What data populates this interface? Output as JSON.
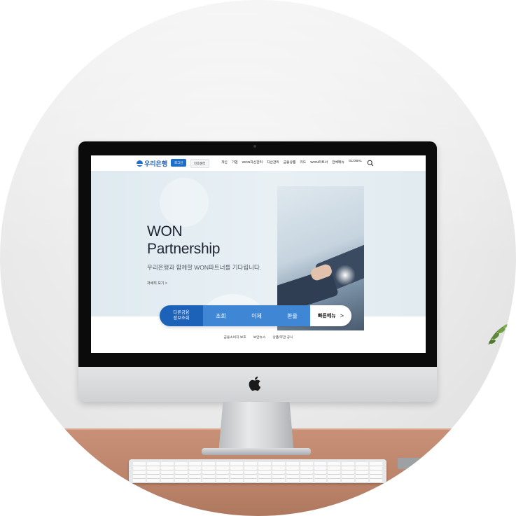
{
  "site": {
    "logo_text": "우리은행",
    "login_label": "로그인",
    "cert_label": "인증센터",
    "nav": [
      "개인",
      "기업",
      "WON자산관리",
      "자산관리",
      "금융상품",
      "카드",
      "WON파트너",
      "전체메뉴",
      "GLOBAL"
    ]
  },
  "hero": {
    "title": "WON\nPartnership",
    "subtitle": "우리은행과 함께할 WON파트너를 기다립니다.",
    "more_link": "자세히 보기 >",
    "pause_glyph": "II",
    "prev_glyph": "<"
  },
  "quickbar": {
    "main_label": "다른금융\n정보조회",
    "items": [
      "조회",
      "이체",
      "환율"
    ],
    "quick_menu": "빠른메뉴",
    "arrow": ">"
  },
  "footer": {
    "links": [
      "금융소비자 보호",
      "보안뉴스",
      "상품/약관 공시"
    ]
  },
  "colors": {
    "brand": "#1c62b9",
    "brand_light": "#3f86d4",
    "hero_bg": "#e3edf2",
    "desk": "#c08a70"
  },
  "icons": [
    "apple-logo-icon",
    "search-icon",
    "plant-icon"
  ]
}
